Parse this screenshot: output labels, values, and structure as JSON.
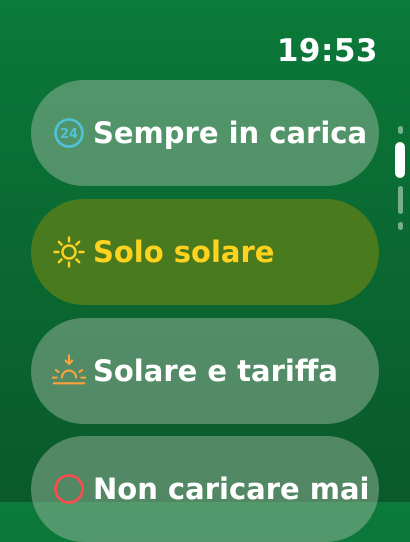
{
  "status": {
    "time": "19:53"
  },
  "colors": {
    "background": "#0b7a3a",
    "selected_background": "#4a7a1e",
    "selected_text": "#ffd21e",
    "icon_24h": "#4fc3d9",
    "icon_sun": "#ffd21e",
    "icon_sunset": "#ffa23a",
    "icon_never": "#ff4b4b"
  },
  "options": [
    {
      "label": "Sempre in carica",
      "icon": "clock-24h-icon",
      "icon_text": "24",
      "selected": false
    },
    {
      "label": "Solo solare",
      "icon": "sun-icon",
      "selected": true
    },
    {
      "label": "Solare e tariffa",
      "icon": "sunset-icon",
      "selected": false
    },
    {
      "label": "Non caricare mai",
      "icon": "circle-icon",
      "selected": false
    }
  ]
}
